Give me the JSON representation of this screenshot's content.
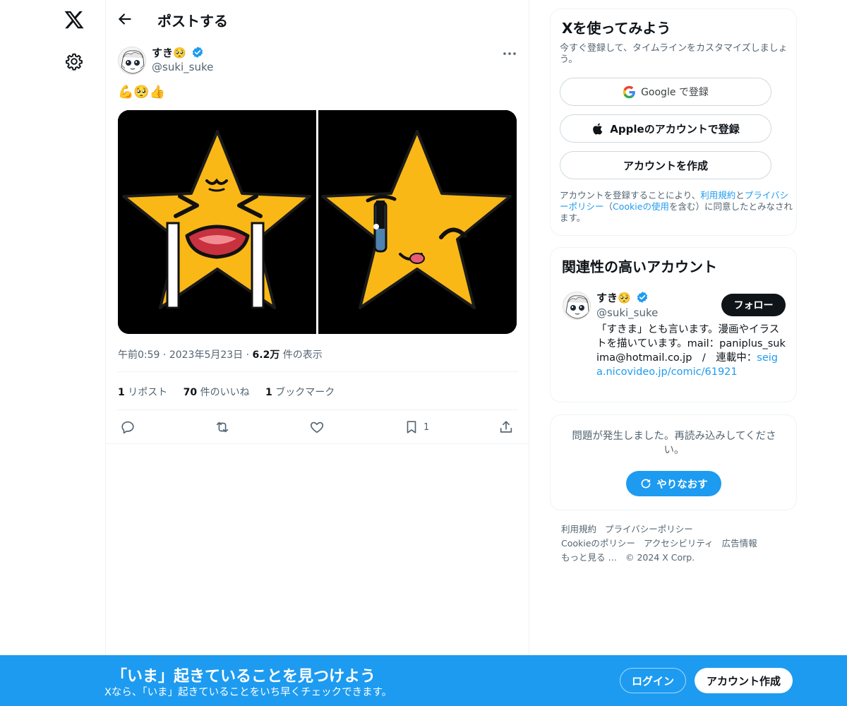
{
  "nav": {
    "logo_icon": "x-logo-icon",
    "settings_icon": "gear-icon"
  },
  "header": {
    "title": "ポストする",
    "back_icon": "arrow-left-icon"
  },
  "post": {
    "author_name": "すき🥺",
    "author_handle": "@suki_suke",
    "text": "💪🥺👍",
    "media": [
      {
        "description": "crying-star"
      },
      {
        "description": "winking-star"
      }
    ],
    "time": "午前0:59",
    "dot1": "·",
    "date": "2023年5月23日",
    "dot2": "·",
    "views_count": "6.2万",
    "views_label": " 件の表示",
    "reposts_count": "1",
    "reposts_label": " リポスト",
    "likes_count": "70",
    "likes_label": " 件のいいね",
    "bookmarks_count": "1",
    "bookmarks_label": " ブックマーク",
    "action_bookmark_count": "1"
  },
  "signup_card": {
    "title": "Xを使ってみよう",
    "subtitle": "今すぐ登録して、タイムラインをカスタマイズしましょう。",
    "google_label": "Google で登録",
    "apple_label": "Appleのアカウントで登録",
    "create_label": "アカウントを作成",
    "legal_prefix": "アカウントを登録することにより、",
    "legal_terms": "利用規約",
    "legal_and": "と",
    "legal_privacy": "プライバシーポリシー",
    "legal_paren_open": "（",
    "legal_cookie": "Cookieの使用",
    "legal_suffix": "を含む）に同意したとみなされます。"
  },
  "related_card": {
    "title": "関連性の高いアカウント",
    "name": "すき🥺",
    "handle": "@suki_suke",
    "follow_label": "フォロー",
    "bio": "「すきま」とも言います。漫画やイラストを描いています。mail：paniplus_sukima@hotmail.co.jp　/　連載中：",
    "bio_link": "seiga.nicovideo.jp/comic/61921"
  },
  "error_card": {
    "message": "問題が発生しました。再読み込みしてください。",
    "retry_label": "やりなおす"
  },
  "footer": {
    "links": [
      "利用規約",
      "プライバシーポリシー",
      "Cookieのポリシー",
      "アクセシビリティ",
      "広告情報",
      "もっと見る …"
    ],
    "copyright": "© 2024 X Corp."
  },
  "bottom_bar": {
    "title": "「いま」起きていることを見つけよう",
    "subtitle": "Xなら、「いま」起きていることをいち早くチェックできます。",
    "login_label": "ログイン",
    "signup_label": "アカウント作成"
  },
  "colors": {
    "accent": "#1d9bf0",
    "text": "#0f1419",
    "secondary": "#536471",
    "star": "#f9b816"
  }
}
